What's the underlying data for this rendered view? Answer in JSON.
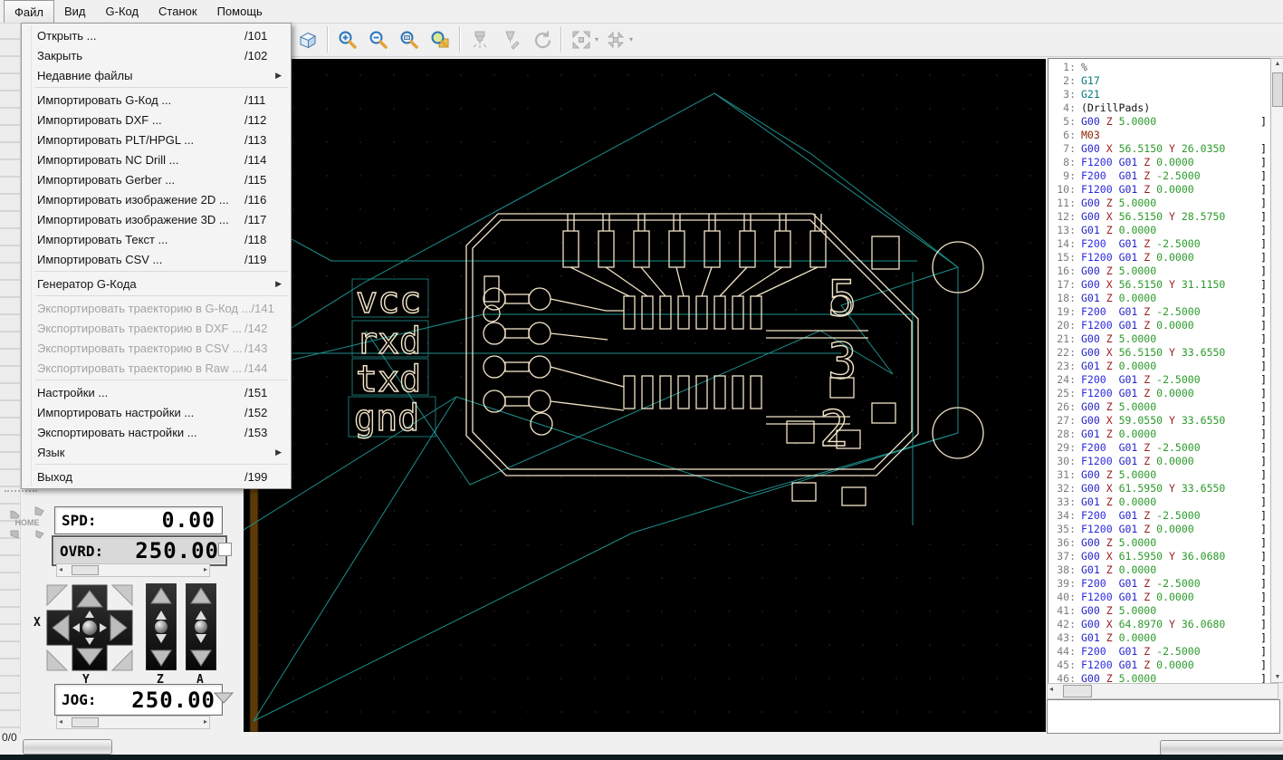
{
  "menubar": {
    "items": [
      {
        "label": "Файл",
        "selected": true
      },
      {
        "label": "Вид",
        "selected": false
      },
      {
        "label": "G-Код",
        "selected": false
      },
      {
        "label": "Станок",
        "selected": false
      },
      {
        "label": "Помощь",
        "selected": false
      }
    ]
  },
  "file_menu": {
    "items": [
      {
        "type": "item",
        "label": "Открыть ...",
        "shortcut": "/101"
      },
      {
        "type": "item",
        "label": "Закрыть",
        "shortcut": "/102"
      },
      {
        "type": "submenu",
        "label": "Недавние файлы"
      },
      {
        "type": "sep"
      },
      {
        "type": "item",
        "label": "Импортировать G-Код ...",
        "shortcut": "/111"
      },
      {
        "type": "item",
        "label": "Импортировать DXF ...",
        "shortcut": "/112"
      },
      {
        "type": "item",
        "label": "Импортировать PLT/HPGL ...",
        "shortcut": "/113"
      },
      {
        "type": "item",
        "label": "Импортировать NC Drill ...",
        "shortcut": "/114"
      },
      {
        "type": "item",
        "label": "Импортировать Gerber ...",
        "shortcut": "/115"
      },
      {
        "type": "item",
        "label": "Импортировать изображение 2D ...",
        "shortcut": "/116"
      },
      {
        "type": "item",
        "label": "Импортировать изображение 3D ...",
        "shortcut": "/117"
      },
      {
        "type": "item",
        "label": "Импортировать Текст ...",
        "shortcut": "/118"
      },
      {
        "type": "item",
        "label": "Импортировать CSV ...",
        "shortcut": "/119"
      },
      {
        "type": "sep"
      },
      {
        "type": "submenu",
        "label": "Генератор G-Кода"
      },
      {
        "type": "sep"
      },
      {
        "type": "item",
        "label": "Экспортировать траекторию в G-Код ...",
        "shortcut": "/141",
        "disabled": true
      },
      {
        "type": "item",
        "label": "Экспортировать траекторию в DXF ...",
        "shortcut": "/142",
        "disabled": true
      },
      {
        "type": "item",
        "label": "Экспортировать траекторию в CSV ...",
        "shortcut": "/143",
        "disabled": true
      },
      {
        "type": "item",
        "label": "Экспортировать траекторию в Raw ...",
        "shortcut": "/144",
        "disabled": true
      },
      {
        "type": "sep"
      },
      {
        "type": "item",
        "label": "Настройки ...",
        "shortcut": "/151"
      },
      {
        "type": "item",
        "label": "Импортировать настройки ...",
        "shortcut": "/152"
      },
      {
        "type": "item",
        "label": "Экспортировать настройки ...",
        "shortcut": "/153"
      },
      {
        "type": "submenu",
        "label": "Язык"
      },
      {
        "type": "sep"
      },
      {
        "type": "item",
        "label": "Выход",
        "shortcut": "/199"
      }
    ]
  },
  "toolbar": {
    "buttons": [
      {
        "type": "button",
        "name": "view-3d-button",
        "icon": "cube",
        "enabled": true
      },
      {
        "type": "sep"
      },
      {
        "type": "button",
        "name": "zoom-in-button",
        "icon": "zoom-in",
        "enabled": true
      },
      {
        "type": "button",
        "name": "zoom-out-button",
        "icon": "zoom-out",
        "enabled": true
      },
      {
        "type": "button",
        "name": "zoom-fit-button",
        "icon": "zoom-fit",
        "enabled": true
      },
      {
        "type": "button",
        "name": "zoom-region-button",
        "icon": "zoom-region",
        "enabled": true
      },
      {
        "type": "sep"
      },
      {
        "type": "button",
        "name": "machine-run-button",
        "icon": "mill",
        "enabled": false
      },
      {
        "type": "button",
        "name": "tool-engrave-button",
        "icon": "tool",
        "enabled": false
      },
      {
        "type": "button",
        "name": "tool-change-button",
        "icon": "rotate-tool",
        "enabled": false
      },
      {
        "type": "sep"
      },
      {
        "type": "button",
        "name": "move-origin-button",
        "icon": "arrows-out",
        "enabled": false,
        "dropdown": true
      },
      {
        "type": "button",
        "name": "set-zero-button",
        "icon": "arrows-in",
        "enabled": false,
        "dropdown": true
      }
    ]
  },
  "left_panel": {
    "home_label": "HOME",
    "spd_label": "SPD:",
    "spd_value": "0.00",
    "ovrd_label": "OVRD:",
    "ovrd_value": "250.00",
    "jog_label": "JOG:",
    "jog_value": "250.00",
    "axis_labels": {
      "x": "X",
      "y": "Y",
      "z": "Z",
      "a": "A"
    }
  },
  "statusbar": {
    "counter": "0/0"
  },
  "canvas": {
    "labels": {
      "l1": "vcc",
      "l2": "rxd",
      "l3": "txd",
      "l4": "gnd"
    },
    "pin_numbers": {
      "n5": "5",
      "n3": "3",
      "n2": "2"
    },
    "colors": {
      "background": "#000000",
      "trace": "#f2e4c8",
      "rapid": "#1e8f8c",
      "ruler": "#5d3a07"
    }
  },
  "gcode_panel": {
    "lines": [
      {
        "n": 1,
        "text": "%"
      },
      {
        "n": 2,
        "text": "G17"
      },
      {
        "n": 3,
        "text": "G21"
      },
      {
        "n": 4,
        "text": "(DrillPads)"
      },
      {
        "n": 5,
        "text": "G00 Z 5.0000",
        "br": true
      },
      {
        "n": 6,
        "text": "M03"
      },
      {
        "n": 7,
        "text": "G00 X 56.5150 Y 26.0350",
        "br": true
      },
      {
        "n": 8,
        "text": "F1200 G01 Z 0.0000",
        "br": true
      },
      {
        "n": 9,
        "text": "F200 G01 Z -2.5000",
        "br": true
      },
      {
        "n": 10,
        "text": "F1200 G01 Z 0.0000",
        "br": true
      },
      {
        "n": 11,
        "text": "G00 Z 5.0000",
        "br": true
      },
      {
        "n": 12,
        "text": "G00 X 56.5150 Y 28.5750",
        "br": true
      },
      {
        "n": 13,
        "text": "G01 Z 0.0000",
        "br": true
      },
      {
        "n": 14,
        "text": "F200 G01 Z -2.5000",
        "br": true
      },
      {
        "n": 15,
        "text": "F1200 G01 Z 0.0000",
        "br": true
      },
      {
        "n": 16,
        "text": "G00 Z 5.0000",
        "br": true
      },
      {
        "n": 17,
        "text": "G00 X 56.5150 Y 31.1150",
        "br": true
      },
      {
        "n": 18,
        "text": "G01 Z 0.0000",
        "br": true
      },
      {
        "n": 19,
        "text": "F200 G01 Z -2.5000",
        "br": true
      },
      {
        "n": 20,
        "text": "F1200 G01 Z 0.0000",
        "br": true
      },
      {
        "n": 21,
        "text": "G00 Z 5.0000",
        "br": true
      },
      {
        "n": 22,
        "text": "G00 X 56.5150 Y 33.6550",
        "br": true
      },
      {
        "n": 23,
        "text": "G01 Z 0.0000",
        "br": true
      },
      {
        "n": 24,
        "text": "F200 G01 Z -2.5000",
        "br": true
      },
      {
        "n": 25,
        "text": "F1200 G01 Z 0.0000",
        "br": true
      },
      {
        "n": 26,
        "text": "G00 Z 5.0000",
        "br": true
      },
      {
        "n": 27,
        "text": "G00 X 59.0550 Y 33.6550",
        "br": true
      },
      {
        "n": 28,
        "text": "G01 Z 0.0000",
        "br": true
      },
      {
        "n": 29,
        "text": "F200 G01 Z -2.5000",
        "br": true
      },
      {
        "n": 30,
        "text": "F1200 G01 Z 0.0000",
        "br": true
      },
      {
        "n": 31,
        "text": "G00 Z 5.0000",
        "br": true
      },
      {
        "n": 32,
        "text": "G00 X 61.5950 Y 33.6550",
        "br": true
      },
      {
        "n": 33,
        "text": "G01 Z 0.0000",
        "br": true
      },
      {
        "n": 34,
        "text": "F200 G01 Z -2.5000",
        "br": true
      },
      {
        "n": 35,
        "text": "F1200 G01 Z 0.0000",
        "br": true
      },
      {
        "n": 36,
        "text": "G00 Z 5.0000",
        "br": true
      },
      {
        "n": 37,
        "text": "G00 X 61.5950 Y 36.0680",
        "br": true
      },
      {
        "n": 38,
        "text": "G01 Z 0.0000",
        "br": true
      },
      {
        "n": 39,
        "text": "F200 G01 Z -2.5000",
        "br": true
      },
      {
        "n": 40,
        "text": "F1200 G01 Z 0.0000",
        "br": true
      },
      {
        "n": 41,
        "text": "G00 Z 5.0000",
        "br": true
      },
      {
        "n": 42,
        "text": "G00 X 64.8970 Y 36.0680",
        "br": true
      },
      {
        "n": 43,
        "text": "G01 Z 0.0000",
        "br": true
      },
      {
        "n": 44,
        "text": "F200 G01 Z -2.5000",
        "br": true
      },
      {
        "n": 45,
        "text": "F1200 G01 Z 0.0000",
        "br": true
      },
      {
        "n": 46,
        "text": "G00 Z 5.0000",
        "br": true
      }
    ]
  }
}
